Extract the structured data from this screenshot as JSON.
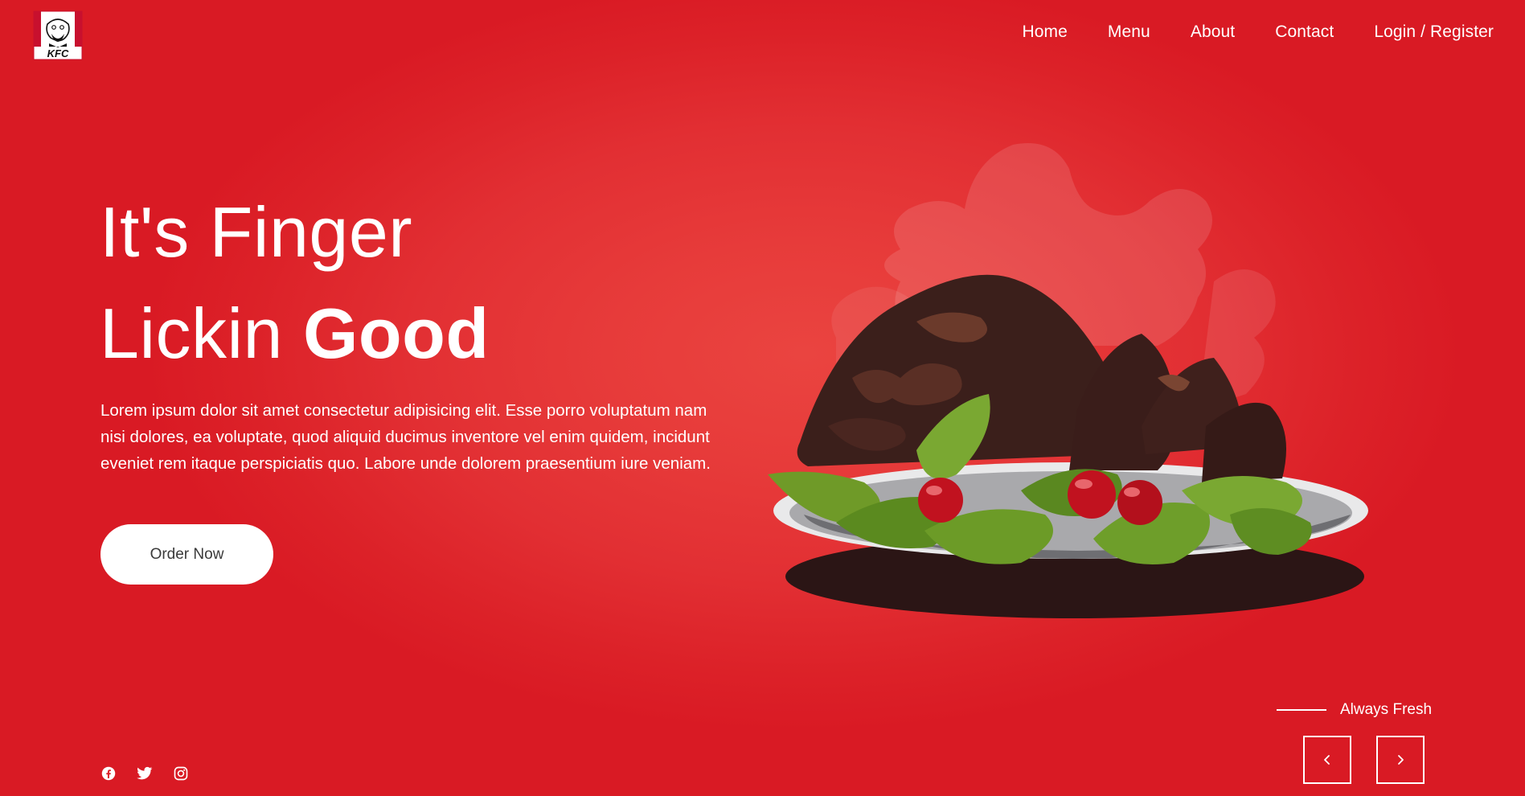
{
  "brand": {
    "logo_text": "KFC"
  },
  "nav": {
    "items": [
      {
        "label": "Home"
      },
      {
        "label": "Menu"
      },
      {
        "label": "About"
      },
      {
        "label": "Contact"
      },
      {
        "label": "Login / Register"
      }
    ]
  },
  "hero": {
    "title_line1": "It's Finger",
    "title_line2_regular": "Lickin",
    "title_line2_bold": "Good",
    "description": "Lorem ipsum dolor sit amet consectetur adipisicing elit. Esse porro voluptatum nam nisi dolores, ea voluptate, quod aliquid ducimus inventore vel enim quidem, incidunt eveniet rem itaque perspiciatis quo. Labore unde dolorem praesentium iure veniam.",
    "cta_label": "Order Now"
  },
  "slider": {
    "tagline": "Always Fresh",
    "prev_icon": "chevron-left-icon",
    "next_icon": "chevron-right-icon"
  },
  "social": {
    "icons": [
      "facebook-icon",
      "twitter-icon",
      "instagram-icon"
    ]
  },
  "colors": {
    "background": "#d91a24",
    "background_glow": "#ea4440",
    "text": "#ffffff",
    "button_bg": "#ffffff",
    "button_text": "#3a3a3a"
  }
}
